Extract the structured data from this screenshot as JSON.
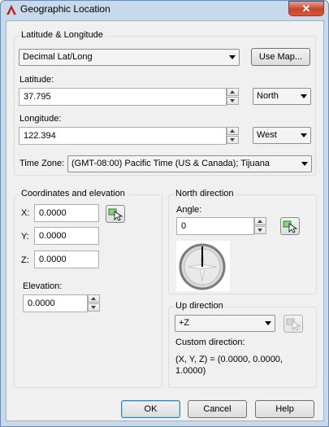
{
  "window": {
    "title": "Geographic Location",
    "close_label": "✕"
  },
  "latlong": {
    "group_label": "Latitude & Longitude",
    "format_value": "Decimal Lat/Long",
    "use_map_label": "Use Map...",
    "latitude_label": "Latitude:",
    "latitude_value": "37.795",
    "latitude_dir": "North",
    "longitude_label": "Longitude:",
    "longitude_value": "122.394",
    "longitude_dir": "West",
    "timezone_label": "Time Zone:",
    "timezone_value": "(GMT-08:00) Pacific Time (US & Canada); Tijuana"
  },
  "coords": {
    "group_label": "Coordinates and elevation",
    "x_label": "X:",
    "x_value": "0.0000",
    "y_label": "Y:",
    "y_value": "0.0000",
    "z_label": "Z:",
    "z_value": "0.0000",
    "elevation_label": "Elevation:",
    "elevation_value": "0.0000"
  },
  "north": {
    "group_label": "North direction",
    "angle_label": "Angle:",
    "angle_value": "0"
  },
  "up": {
    "group_label": "Up direction",
    "direction_value": "+Z",
    "custom_label": "Custom direction:",
    "custom_value": "(X, Y, Z) = (0.0000, 0.0000, 1.0000)"
  },
  "buttons": {
    "ok": "OK",
    "cancel": "Cancel",
    "help": "Help"
  }
}
